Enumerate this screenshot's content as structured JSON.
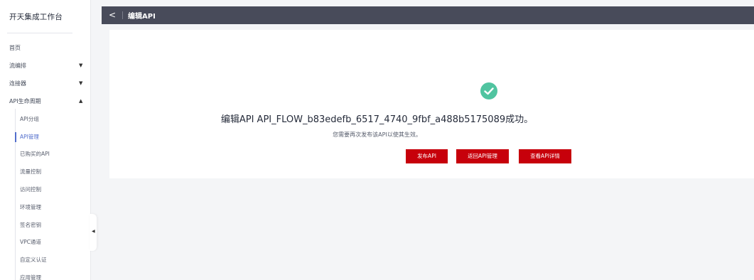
{
  "sidebar": {
    "title": "开天集成工作台",
    "items": [
      {
        "label": "首页",
        "arrow": ""
      },
      {
        "label": "流编排",
        "arrow": "▼"
      },
      {
        "label": "连接器",
        "arrow": "▼"
      },
      {
        "label": "API生命周期",
        "arrow": "▲"
      }
    ],
    "sub_items": [
      {
        "label": "API分组"
      },
      {
        "label": "API管理"
      },
      {
        "label": "已购买的API"
      },
      {
        "label": "流量控制"
      },
      {
        "label": "访问控制"
      },
      {
        "label": "环境管理"
      },
      {
        "label": "签名密钥"
      },
      {
        "label": "VPC通道"
      },
      {
        "label": "自定义认证"
      },
      {
        "label": "应用管理"
      }
    ],
    "active_sub": "API管理",
    "collapse_glyph": "◀"
  },
  "header": {
    "back_glyph": "<",
    "title": "编辑API"
  },
  "result": {
    "icon": "check-circle-icon",
    "message": "编辑API API_FLOW_b83edefb_6517_4740_9fbf_a488b5175089成功。",
    "sub_message": "您需要再次发布该API以使其生效。",
    "buttons": {
      "publish": "发布API",
      "back_to_manage": "返回API管理",
      "view_details": "查看API详情"
    }
  },
  "colors": {
    "topbar": "#484b5a",
    "success": "#50c4a0",
    "primary_button": "#c7000b",
    "active_link": "#526ecc",
    "page_bg": "#f4f5f7"
  }
}
